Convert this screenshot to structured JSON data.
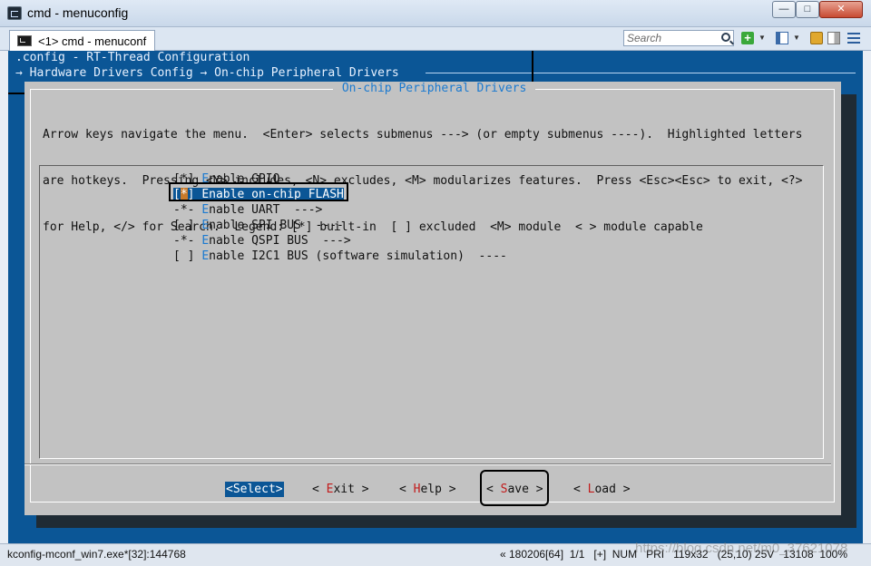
{
  "window": {
    "title": "cmd - menuconfig",
    "min_glyph": "—",
    "max_glyph": "□",
    "close_glyph": "✕"
  },
  "tabbar": {
    "tab_label": "<1> cmd - menuconf",
    "search_placeholder": "Search",
    "add_glyph": "+",
    "menu_caret": "▼"
  },
  "terminal": {
    "config_title": ".config - RT-Thread Configuration",
    "breadcrumb": "→ Hardware Drivers Config → On-chip Peripheral Drivers"
  },
  "dialog": {
    "title": " On-chip Peripheral Drivers ",
    "help_lines": [
      "Arrow keys navigate the menu.  <Enter> selects submenus ---> (or empty submenus ----).  Highlighted letters",
      "are hotkeys.  Pressing <Y> includes, <N> excludes, <M> modularizes features.  Press <Esc><Esc> to exit, <?>",
      "for Help, </> for Search.  Legend: [*] built-in  [ ] excluded  <M> module  < > module capable"
    ],
    "items": [
      {
        "prefix": "[*] ",
        "hotkey": "E",
        "rest": "nable GPIO"
      },
      {
        "prefix_open": "[",
        "cursor": "*",
        "prefix_close": "] ",
        "hotkey": "E",
        "rest": "nable on-chip FLASH"
      },
      {
        "prefix": "-*- ",
        "hotkey": "E",
        "rest": "nable UART  --->"
      },
      {
        "prefix": "[ ] ",
        "hotkey": "E",
        "rest": "nable SPI BUS  ----"
      },
      {
        "prefix": "-*- ",
        "hotkey": "E",
        "rest": "nable QSPI BUS  --->"
      },
      {
        "prefix": "[ ] ",
        "hotkey": "E",
        "rest": "nable I2C1 BUS (software simulation)  ----"
      }
    ],
    "buttons": {
      "select": "<Select>",
      "exit_pre": "< ",
      "exit_hk": "E",
      "exit_rest": "xit >",
      "help_pre": "< ",
      "help_hk": "H",
      "help_rest": "elp >",
      "save_pre": "< ",
      "save_hk": "S",
      "save_rest": "ave >",
      "load_pre": "< ",
      "load_hk": "L",
      "load_rest": "oad >"
    }
  },
  "statusbar": {
    "left": "kconfig-mconf_win7.exe*[32]:144768",
    "right": "« 180206[64]  1/1   [+]  NUM   PRI   119x32   (25,10) 25V   13108  100%",
    "watermark": "https://blog.csdn.net/m0_37621078"
  }
}
